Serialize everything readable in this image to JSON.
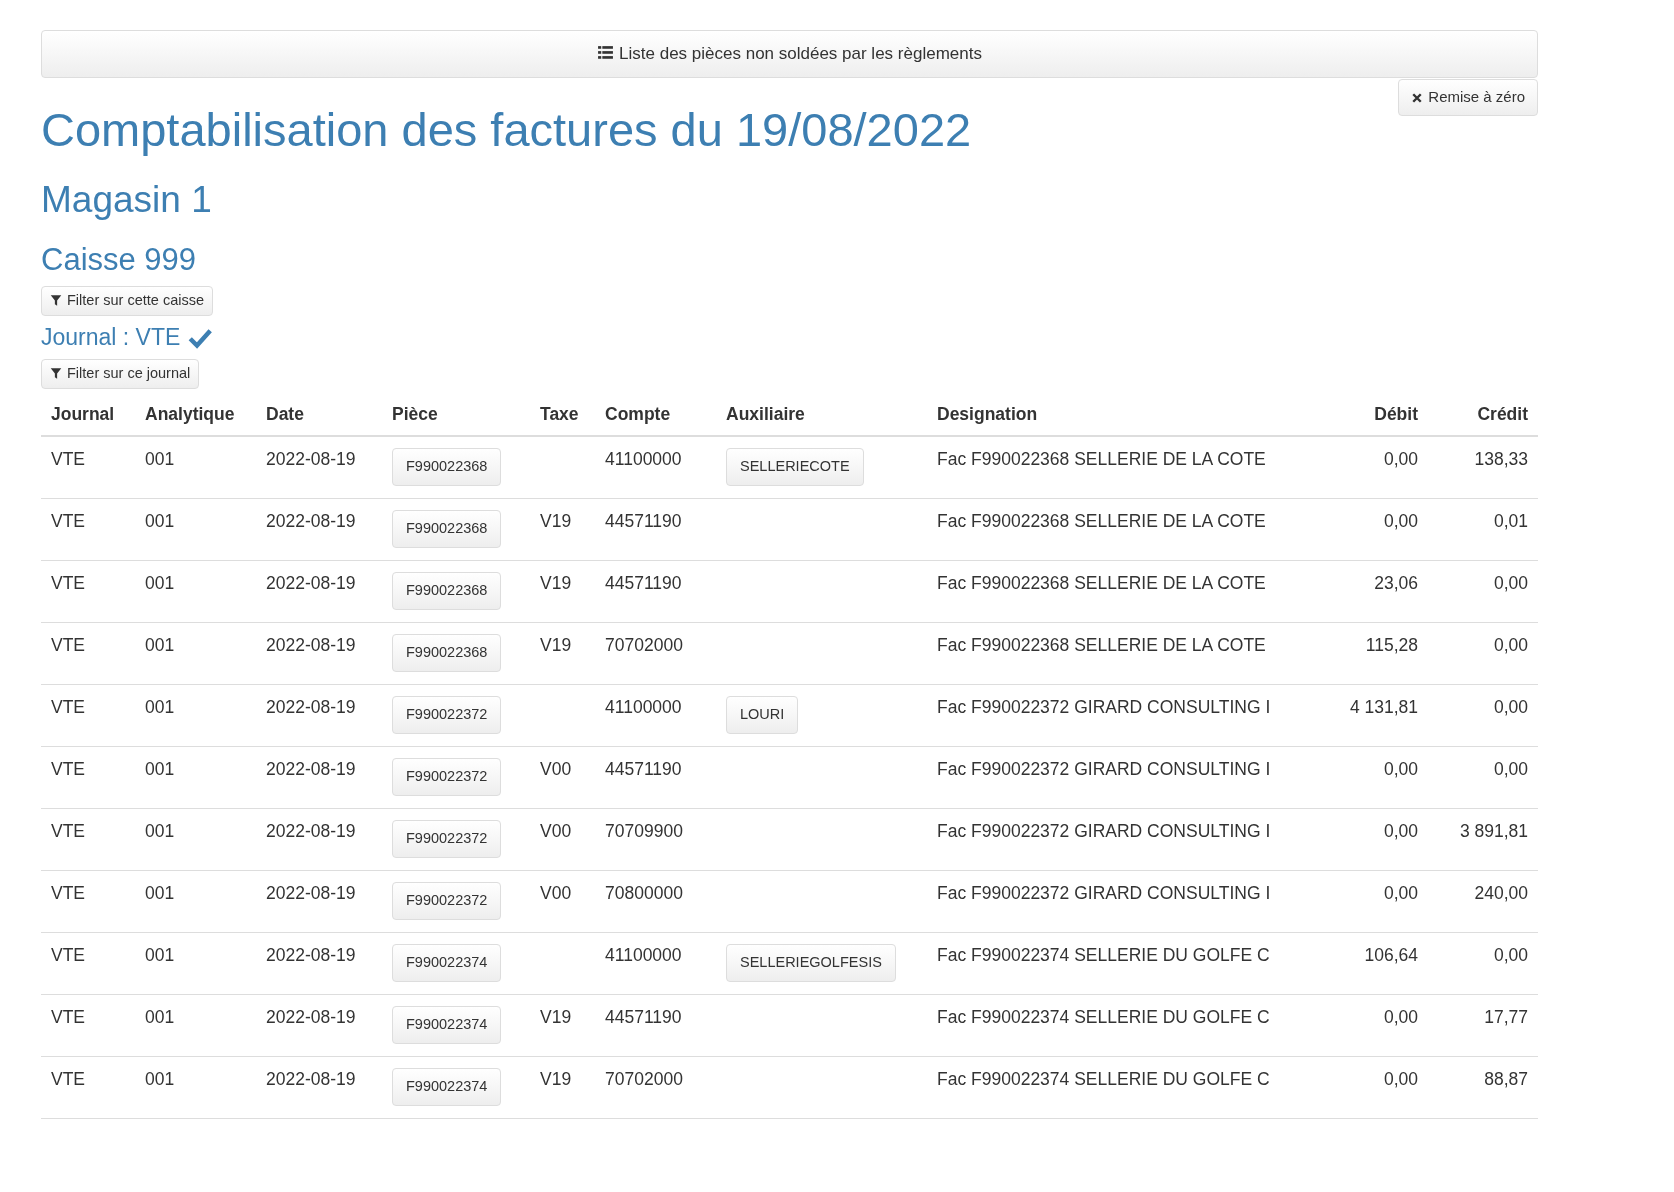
{
  "top_button": {
    "label": "Liste des pièces non soldées par les règlements"
  },
  "reset_button": {
    "label": "Remise à zéro"
  },
  "title": "Comptabilisation des factures du 19/08/2022",
  "store": "Magasin 1",
  "register": "Caisse 999",
  "register_filter": {
    "label": "Filter sur cette caisse"
  },
  "journal": {
    "label": "Journal : VTE",
    "checked": true
  },
  "journal_filter": {
    "label": "Filter sur ce journal"
  },
  "table": {
    "columns": [
      "Journal",
      "Analytique",
      "Date",
      "Pièce",
      "Taxe",
      "Compte",
      "Auxiliaire",
      "Designation",
      "Débit",
      "Crédit"
    ],
    "rows": [
      {
        "journal": "VTE",
        "analytique": "001",
        "date": "2022-08-19",
        "piece": "F990022368",
        "taxe": "",
        "compte": "41100000",
        "auxiliaire": "SELLERIECOTE",
        "designation": "Fac F990022368 SELLERIE DE LA COTE",
        "debit": "0,00",
        "credit": "138,33"
      },
      {
        "journal": "VTE",
        "analytique": "001",
        "date": "2022-08-19",
        "piece": "F990022368",
        "taxe": "V19",
        "compte": "44571190",
        "auxiliaire": "",
        "designation": "Fac F990022368 SELLERIE DE LA COTE",
        "debit": "0,00",
        "credit": "0,01"
      },
      {
        "journal": "VTE",
        "analytique": "001",
        "date": "2022-08-19",
        "piece": "F990022368",
        "taxe": "V19",
        "compte": "44571190",
        "auxiliaire": "",
        "designation": "Fac F990022368 SELLERIE DE LA COTE",
        "debit": "23,06",
        "credit": "0,00"
      },
      {
        "journal": "VTE",
        "analytique": "001",
        "date": "2022-08-19",
        "piece": "F990022368",
        "taxe": "V19",
        "compte": "70702000",
        "auxiliaire": "",
        "designation": "Fac F990022368 SELLERIE DE LA COTE",
        "debit": "115,28",
        "credit": "0,00"
      },
      {
        "journal": "VTE",
        "analytique": "001",
        "date": "2022-08-19",
        "piece": "F990022372",
        "taxe": "",
        "compte": "41100000",
        "auxiliaire": "LOURI",
        "designation": "Fac F990022372 GIRARD CONSULTING I",
        "debit": "4 131,81",
        "credit": "0,00"
      },
      {
        "journal": "VTE",
        "analytique": "001",
        "date": "2022-08-19",
        "piece": "F990022372",
        "taxe": "V00",
        "compte": "44571190",
        "auxiliaire": "",
        "designation": "Fac F990022372 GIRARD CONSULTING I",
        "debit": "0,00",
        "credit": "0,00"
      },
      {
        "journal": "VTE",
        "analytique": "001",
        "date": "2022-08-19",
        "piece": "F990022372",
        "taxe": "V00",
        "compte": "70709900",
        "auxiliaire": "",
        "designation": "Fac F990022372 GIRARD CONSULTING I",
        "debit": "0,00",
        "credit": "3 891,81"
      },
      {
        "journal": "VTE",
        "analytique": "001",
        "date": "2022-08-19",
        "piece": "F990022372",
        "taxe": "V00",
        "compte": "70800000",
        "auxiliaire": "",
        "designation": "Fac F990022372 GIRARD CONSULTING I",
        "debit": "0,00",
        "credit": "240,00"
      },
      {
        "journal": "VTE",
        "analytique": "001",
        "date": "2022-08-19",
        "piece": "F990022374",
        "taxe": "",
        "compte": "41100000",
        "auxiliaire": "SELLERIEGOLFESIS",
        "designation": "Fac F990022374 SELLERIE DU GOLFE C",
        "debit": "106,64",
        "credit": "0,00"
      },
      {
        "journal": "VTE",
        "analytique": "001",
        "date": "2022-08-19",
        "piece": "F990022374",
        "taxe": "V19",
        "compte": "44571190",
        "auxiliaire": "",
        "designation": "Fac F990022374 SELLERIE DU GOLFE C",
        "debit": "0,00",
        "credit": "17,77"
      },
      {
        "journal": "VTE",
        "analytique": "001",
        "date": "2022-08-19",
        "piece": "F990022374",
        "taxe": "V19",
        "compte": "70702000",
        "auxiliaire": "",
        "designation": "Fac F990022374 SELLERIE DU GOLFE C",
        "debit": "0,00",
        "credit": "88,87"
      }
    ]
  }
}
